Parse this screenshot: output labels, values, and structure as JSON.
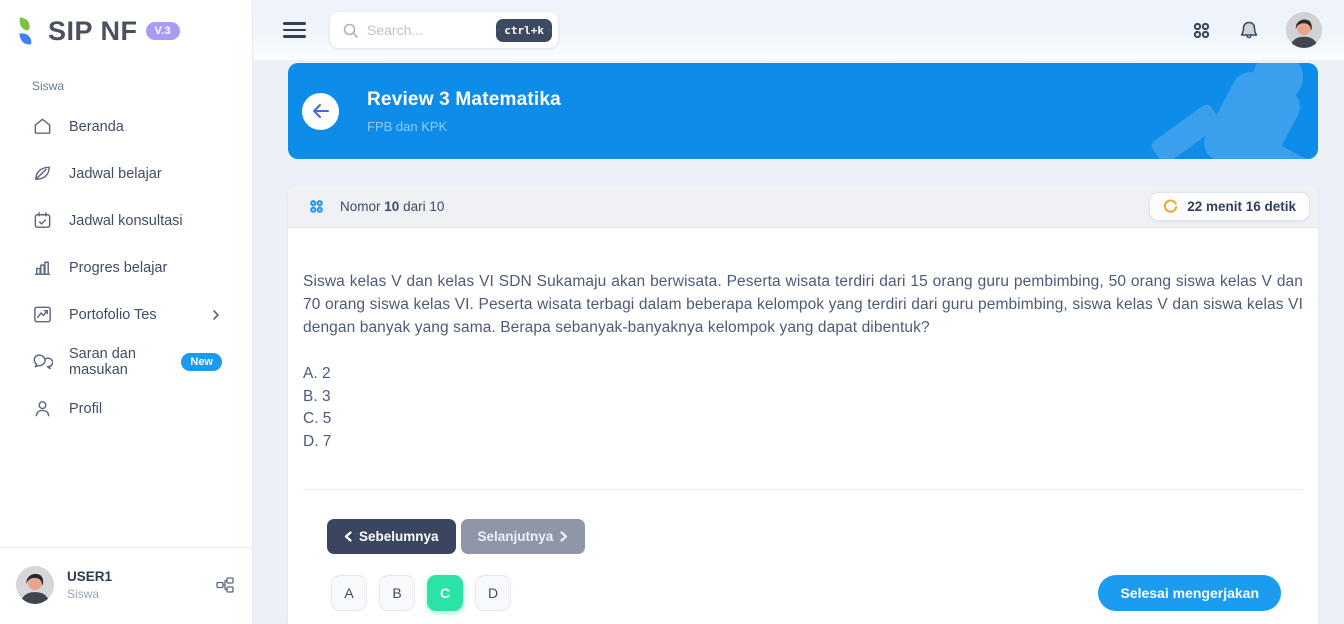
{
  "brand": {
    "name": "SIP NF",
    "version_badge": "V.3"
  },
  "sidebar": {
    "section_label": "Siswa",
    "items": [
      {
        "label": "Beranda",
        "icon": "home-icon"
      },
      {
        "label": "Jadwal belajar",
        "icon": "leaf-icon"
      },
      {
        "label": "Jadwal konsultasi",
        "icon": "calendar-check-icon"
      },
      {
        "label": "Progres belajar",
        "icon": "bar-chart-icon"
      },
      {
        "label": "Portofolio Tes",
        "icon": "trending-chart-icon",
        "has_submenu": true
      },
      {
        "label": "Saran dan masukan",
        "icon": "chat-icon",
        "badge": "New"
      },
      {
        "label": "Profil",
        "icon": "user-icon"
      }
    ],
    "user": {
      "name": "USER1",
      "role": "Siswa"
    }
  },
  "topbar": {
    "search_placeholder": "Search...",
    "search_value": "",
    "shortcut": "ctrl+k"
  },
  "quiz_header": {
    "title": "Review 3 Matematika",
    "subtitle": "FPB dan KPK"
  },
  "question": {
    "label_prefix": "Nomor",
    "number": "10",
    "label_suffix": "dari 10",
    "timer": "22 menit 16 detik",
    "text": "Siswa kelas V dan kelas VI SDN Sukamaju akan berwisata. Peserta wisata terdiri dari 15 orang guru pembimbing, 50 orang siswa kelas V dan 70 orang siswa kelas VI. Peserta wisata terbagi dalam beberapa kelompok yang terdiri dari guru pembimbing, siswa kelas V dan siswa kelas VI dengan banyak yang sama. Berapa sebanyak-banyaknya kelompok yang dapat dibentuk?",
    "options": [
      "A. 2",
      "B. 3",
      "C. 5",
      "D. 7"
    ]
  },
  "controls": {
    "prev_label": "Sebelumnya",
    "next_label": "Selanjutnya",
    "answer_buttons": [
      "A",
      "B",
      "C",
      "D"
    ],
    "selected_answer": "C",
    "finish_label": "Selesai mengerjakan"
  },
  "colors": {
    "accent_blue": "#0d8ce9",
    "finish_blue": "#1b9cf0",
    "selected_green": "#2ce3a7",
    "dark_navy": "#3a4560",
    "disabled_gray": "#8e96a8",
    "version_badge_purple": "#a99cf2",
    "new_badge_blue": "#1b9af2",
    "timer_icon_orange": "#f0a832"
  }
}
